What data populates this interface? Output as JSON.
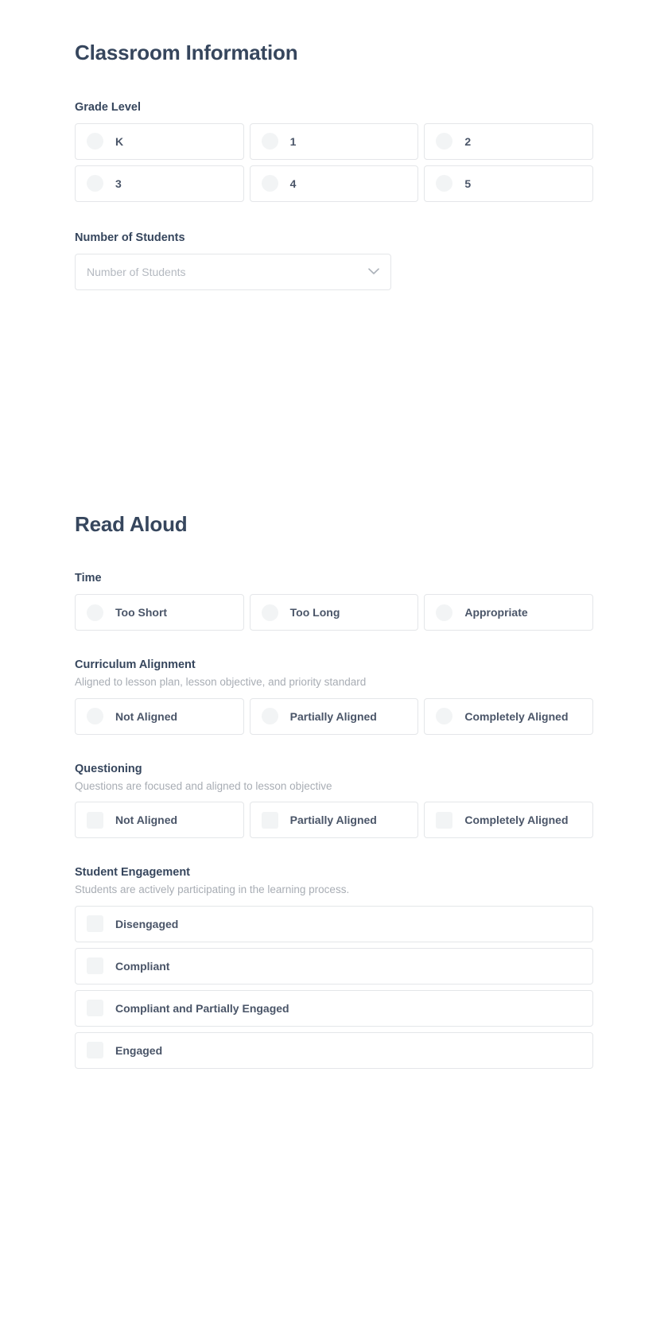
{
  "theme": {
    "heading_color": "#36465d",
    "label_color": "#36465d",
    "description_color": "#a8adb4",
    "option_text_color": "#4a5568",
    "card_border_color": "#e4e6e9",
    "control_fill_color": "#f2f4f5",
    "placeholder_color": "#b4b9c0",
    "page_background": "#ffffff"
  },
  "sections": [
    {
      "id": "classroom-information",
      "title": "Classroom Information",
      "fields": [
        {
          "id": "grade-level",
          "label": "Grade Level",
          "description": "",
          "control": "radio",
          "layout": "grid-3",
          "options": [
            {
              "label": "K",
              "selected": false
            },
            {
              "label": "1",
              "selected": false
            },
            {
              "label": "2",
              "selected": false
            },
            {
              "label": "3",
              "selected": false
            },
            {
              "label": "4",
              "selected": false
            },
            {
              "label": "5",
              "selected": false
            }
          ]
        },
        {
          "id": "number-of-students",
          "label": "Number of Students",
          "description": "",
          "control": "select",
          "placeholder": "Number of Students",
          "value": "",
          "icon": "chevron-down-icon"
        }
      ]
    },
    {
      "id": "read-aloud",
      "title": "Read Aloud",
      "fields": [
        {
          "id": "time",
          "label": "Time",
          "description": "",
          "control": "radio",
          "layout": "grid-3",
          "options": [
            {
              "label": "Too Short",
              "selected": false
            },
            {
              "label": "Too Long",
              "selected": false
            },
            {
              "label": "Appropriate",
              "selected": false
            }
          ]
        },
        {
          "id": "curriculum-alignment",
          "label": "Curriculum Alignment",
          "description": "Aligned to lesson plan, lesson objective, and priority standard",
          "control": "radio",
          "layout": "grid-3",
          "options": [
            {
              "label": "Not Aligned",
              "selected": false
            },
            {
              "label": "Partially Aligned",
              "selected": false
            },
            {
              "label": "Completely Aligned",
              "selected": false
            }
          ]
        },
        {
          "id": "questioning",
          "label": "Questioning",
          "description": "Questions are focused and aligned to lesson objective",
          "control": "checkbox",
          "layout": "grid-3",
          "options": [
            {
              "label": "Not Aligned",
              "selected": false
            },
            {
              "label": "Partially Aligned",
              "selected": false
            },
            {
              "label": "Completely Aligned",
              "selected": false
            }
          ]
        },
        {
          "id": "student-engagement",
          "label": "Student Engagement",
          "description": "Students are actively participating in the learning process.",
          "control": "checkbox",
          "layout": "list",
          "options": [
            {
              "label": "Disengaged",
              "selected": false
            },
            {
              "label": "Compliant",
              "selected": false
            },
            {
              "label": "Compliant and Partially Engaged",
              "selected": false
            },
            {
              "label": "Engaged",
              "selected": false
            }
          ]
        }
      ]
    }
  ]
}
